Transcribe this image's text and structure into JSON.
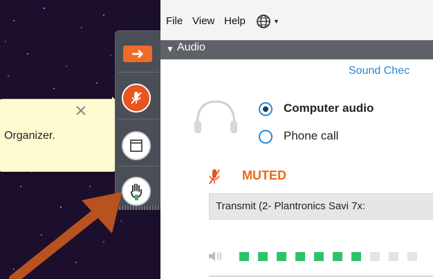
{
  "menu": {
    "file": "File",
    "view": "View",
    "help": "Help"
  },
  "audio": {
    "title": "Audio",
    "sound_check": "Sound Chec",
    "options": [
      {
        "label": "Computer audio",
        "selected": true
      },
      {
        "label": "Phone call",
        "selected": false
      }
    ],
    "status": "MUTED",
    "transmit_device": "Transmit (2- Plantronics Savi 7x:",
    "level": {
      "lit": 7,
      "total": 10
    }
  },
  "tooltip": {
    "text": "Organizer."
  },
  "icons": {
    "expand": "right-arrow-icon",
    "mute": "microphone-muted-icon",
    "chat": "chat-window-icon",
    "raise_hand": "raise-hand-icon",
    "globe": "globe-icon",
    "headset": "headset-icon",
    "speaker": "speaker-icon",
    "close": "close-icon"
  },
  "colors": {
    "accent_orange": "#e8551f",
    "muted_text": "#e86a1c",
    "link_blue": "#2a86d6",
    "level_on": "#2ec36a",
    "level_off": "#e4e4e4",
    "toolbar_bg": "#4a4e56",
    "audio_header_bg": "#5e6268",
    "tooltip_bg": "#fffbd1"
  }
}
